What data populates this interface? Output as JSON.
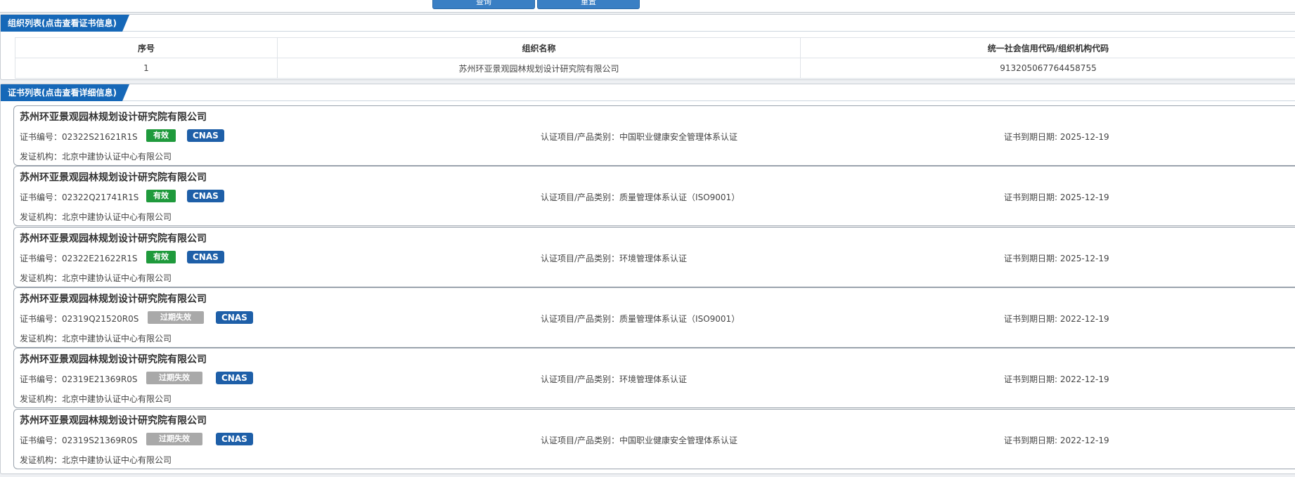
{
  "top_panel": {
    "search_label": "查询",
    "reset_label": "重置"
  },
  "org_panel": {
    "title": "组织列表(点击查看证书信息)",
    "columns": [
      "序号",
      "组织名称",
      "统一社会信用代码/组织机构代码"
    ],
    "rows": [
      {
        "index": "1",
        "name": "苏州环亚景观园林规划设计研究院有限公司",
        "code": "913205067764458755"
      }
    ]
  },
  "cert_panel": {
    "title": "证书列表(点击查看详细信息)",
    "labels": {
      "cert_no": "证书编号：",
      "item": "认证项目/产品类别：",
      "expiry": "证书到期日期:",
      "issuer": "发证机构："
    },
    "certs": [
      {
        "org": "苏州环亚景观园林规划设计研究院有限公司",
        "cert_no": "02322S21621R1S",
        "status": "有效",
        "accreditation": "CNAS",
        "item": "中国职业健康安全管理体系认证",
        "expiry": "2025-12-19",
        "issuer": "北京中建协认证中心有限公司"
      },
      {
        "org": "苏州环亚景观园林规划设计研究院有限公司",
        "cert_no": "02322Q21741R1S",
        "status": "有效",
        "accreditation": "CNAS",
        "item": "质量管理体系认证（ISO9001）",
        "expiry": "2025-12-19",
        "issuer": "北京中建协认证中心有限公司"
      },
      {
        "org": "苏州环亚景观园林规划设计研究院有限公司",
        "cert_no": "02322E21622R1S",
        "status": "有效",
        "accreditation": "CNAS",
        "item": "环境管理体系认证",
        "expiry": "2025-12-19",
        "issuer": "北京中建协认证中心有限公司"
      },
      {
        "org": "苏州环亚景观园林规划设计研究院有限公司",
        "cert_no": "02319Q21520R0S",
        "status": "过期失效",
        "accreditation": "CNAS",
        "item": "质量管理体系认证（ISO9001）",
        "expiry": "2022-12-19",
        "issuer": "北京中建协认证中心有限公司"
      },
      {
        "org": "苏州环亚景观园林规划设计研究院有限公司",
        "cert_no": "02319E21369R0S",
        "status": "过期失效",
        "accreditation": "CNAS",
        "item": "环境管理体系认证",
        "expiry": "2022-12-19",
        "issuer": "北京中建协认证中心有限公司"
      },
      {
        "org": "苏州环亚景观园林规划设计研究院有限公司",
        "cert_no": "02319S21369R0S",
        "status": "过期失效",
        "accreditation": "CNAS",
        "item": "中国职业健康安全管理体系认证",
        "expiry": "2022-12-19",
        "issuer": "北京中建协认证中心有限公司"
      }
    ]
  },
  "colors": {
    "title_bar": "#1668b8",
    "status_valid": "#1f9a3c",
    "status_expired": "#a9a9a9",
    "cnas": "#1e5fa8"
  }
}
